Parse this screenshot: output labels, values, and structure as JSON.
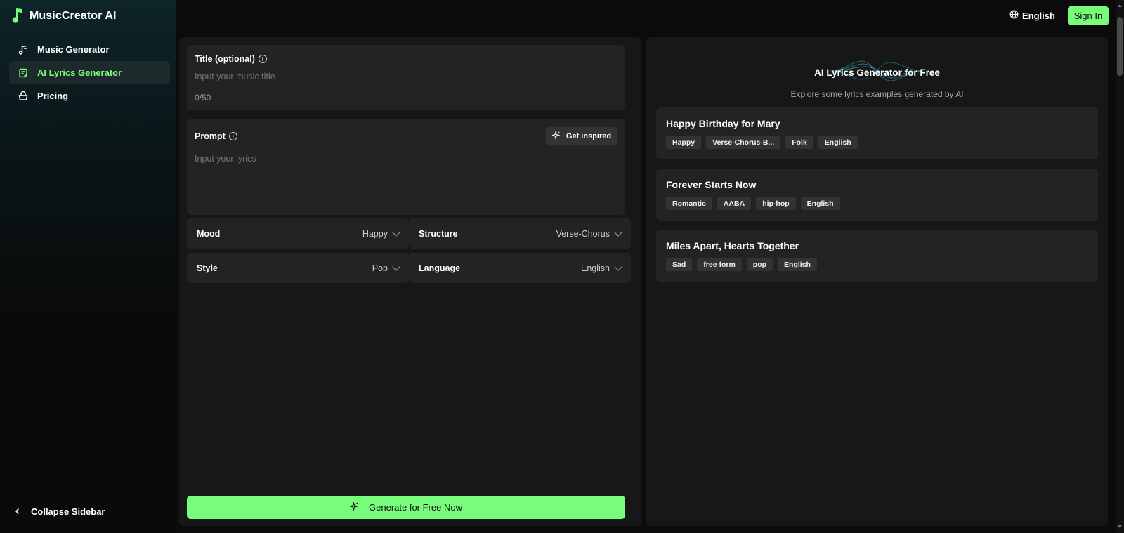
{
  "brand": {
    "name": "MusicCreator AI",
    "accent": "#78fc7b"
  },
  "header": {
    "language": "English",
    "signin_label": "Sign In"
  },
  "sidebar": {
    "items": [
      {
        "label": "Music Generator",
        "icon": "music-note-icon"
      },
      {
        "label": "AI Lyrics Generator",
        "icon": "document-icon"
      },
      {
        "label": "Pricing",
        "icon": "basket-icon"
      }
    ],
    "collapse_label": "Collapse Sidebar"
  },
  "form": {
    "title_label": "Title (optional)",
    "title_placeholder": "Input your music title",
    "title_counter": "0/50",
    "prompt_label": "Prompt",
    "prompt_placeholder": "Input your lyrics",
    "inspire_label": "Get inspired",
    "mood": {
      "label": "Mood",
      "value": "Happy"
    },
    "structure": {
      "label": "Structure",
      "value": "Verse-Chorus"
    },
    "style": {
      "label": "Style",
      "value": "Pop"
    },
    "language": {
      "label": "Language",
      "value": "English"
    },
    "generate_label": "Generate for Free Now"
  },
  "examples_panel": {
    "title": "AI Lyrics Generator for Free",
    "subtitle": "Explore some lyrics examples generated by AI",
    "examples": [
      {
        "title": "Happy Birthday for Mary",
        "tags": [
          "Happy",
          "Verse-Chorus-B...",
          "Folk",
          "English"
        ]
      },
      {
        "title": "Forever Starts Now",
        "tags": [
          "Romantic",
          "AABA",
          "hip-hop",
          "English"
        ]
      },
      {
        "title": "Miles Apart, Hearts Together",
        "tags": [
          "Sad",
          "free form",
          "pop",
          "English"
        ]
      }
    ]
  }
}
